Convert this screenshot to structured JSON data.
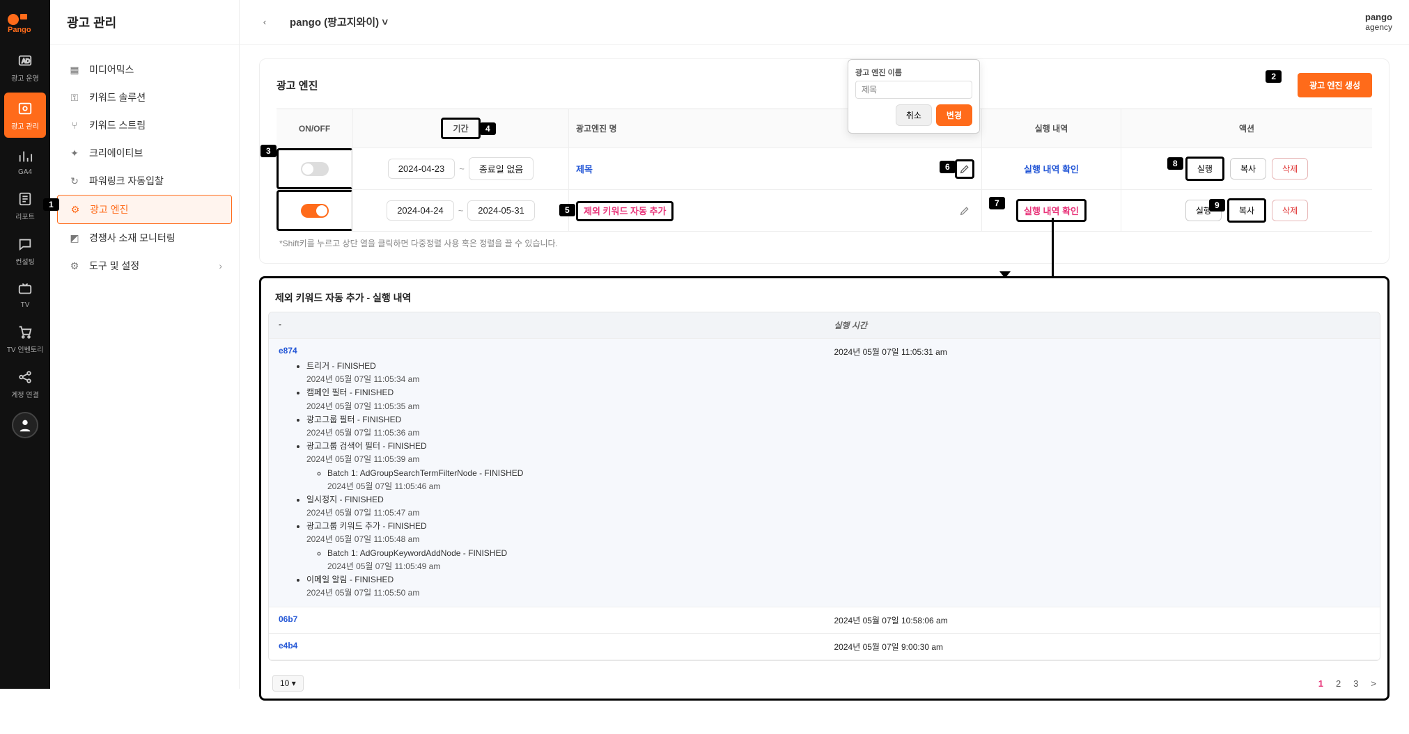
{
  "app": {
    "logo_text": "Pango"
  },
  "rail": [
    {
      "id": "ops",
      "label": "광고 운영",
      "icon": "ad-icon"
    },
    {
      "id": "mgmt",
      "label": "광고 관리",
      "icon": "gear-box-icon",
      "active": true
    },
    {
      "id": "ga4",
      "label": "GA4",
      "icon": "bar-chart-icon"
    },
    {
      "id": "report",
      "label": "리포트",
      "icon": "report-icon"
    },
    {
      "id": "consult",
      "label": "컨설팅",
      "icon": "chat-icon"
    },
    {
      "id": "tv",
      "label": "TV",
      "icon": "tv-icon"
    },
    {
      "id": "tvinv",
      "label": "TV 인벤토리",
      "icon": "cart-icon"
    },
    {
      "id": "link",
      "label": "계정 연결",
      "icon": "share-icon"
    }
  ],
  "sidebar": {
    "title": "광고 관리",
    "items": [
      {
        "label": "미디어믹스",
        "icon": "calendar-icon"
      },
      {
        "label": "키워드 솔루션",
        "icon": "key-icon"
      },
      {
        "label": "키워드 스트림",
        "icon": "branch-icon"
      },
      {
        "label": "크리에이티브",
        "icon": "sparkle-icon"
      },
      {
        "label": "파워링크 자동입찰",
        "icon": "loop-icon"
      },
      {
        "label": "광고 엔진",
        "icon": "gear-icon",
        "active": true
      },
      {
        "label": "경쟁사 소재 모니터링",
        "icon": "monitor-icon"
      },
      {
        "label": "도구 및 설정",
        "icon": "gear-icon",
        "chevron": true
      }
    ]
  },
  "topbar": {
    "account_picker": "pango (팡고지와이)",
    "chevron": "˅",
    "agency_name": "pango",
    "agency_sub": "agency"
  },
  "engine_panel": {
    "title": "광고 엔진",
    "create_button": "광고 엔진 생성",
    "columns": {
      "onoff": "ON/OFF",
      "period": "기간",
      "name": "광고엔진 명",
      "history": "실행 내역",
      "actions": "액션"
    },
    "popover": {
      "label": "광고 엔진 이름",
      "placeholder": "제목",
      "cancel": "취소",
      "save": "변경"
    },
    "rows": [
      {
        "on": false,
        "start": "2024-04-23",
        "end": "종료일 없음",
        "name": "제목",
        "history": "실행 내역 확인",
        "run": "실행",
        "copy": "복사",
        "del": "삭제"
      },
      {
        "on": true,
        "start": "2024-04-24",
        "end": "2024-05-31",
        "name": "제외 키워드 자동 추가",
        "history": "실행 내역 확인",
        "run": "실행",
        "copy": "복사",
        "del": "삭제"
      }
    ],
    "hint": "*Shift키를 누르고 상단 열을 클릭하면 다중정렬 사용 혹은 정렬을 끌 수 있습니다."
  },
  "history_panel": {
    "title": "제외 키워드 자동 추가 - 실행 내역",
    "col_left_placeholder": "-",
    "col_right": "실행 시간",
    "expanded": {
      "id": "e874",
      "exec_time": "2024년 05월 07일 11:05:31 am",
      "steps": [
        {
          "name": "트리거 - FINISHED",
          "time": "2024년 05월 07일 11:05:34 am"
        },
        {
          "name": "캠페인 필터 - FINISHED",
          "time": "2024년 05월 07일 11:05:35 am"
        },
        {
          "name": "광고그룹 필터 - FINISHED",
          "time": "2024년 05월 07일 11:05:36 am"
        },
        {
          "name": "광고그룹 검색어 필터 - FINISHED",
          "time": "2024년 05월 07일 11:05:39 am",
          "sub": [
            {
              "name": "Batch 1: AdGroupSearchTermFilterNode - FINISHED",
              "time": "2024년 05월 07일 11:05:46 am"
            }
          ]
        },
        {
          "name": "일시정지 - FINISHED",
          "time": "2024년 05월 07일 11:05:47 am"
        },
        {
          "name": "광고그룹 키워드 추가 - FINISHED",
          "time": "2024년 05월 07일 11:05:48 am",
          "sub": [
            {
              "name": "Batch 1: AdGroupKeywordAddNode - FINISHED",
              "time": "2024년 05월 07일 11:05:49 am"
            }
          ]
        },
        {
          "name": "이메일 알림 - FINISHED",
          "time": "2024년 05월 07일 11:05:50 am"
        }
      ]
    },
    "others": [
      {
        "id": "06b7",
        "exec_time": "2024년 05월 07일 10:58:06 am"
      },
      {
        "id": "e4b4",
        "exec_time": "2024년 05월 07일 9:00:30 am"
      }
    ],
    "page_size": "10",
    "pages": [
      "1",
      "2",
      "3"
    ],
    "next_glyph": ">"
  },
  "markers": {
    "1": "1",
    "2": "2",
    "3": "3",
    "4": "4",
    "5": "5",
    "6": "6",
    "7": "7",
    "8": "8",
    "9": "9"
  }
}
